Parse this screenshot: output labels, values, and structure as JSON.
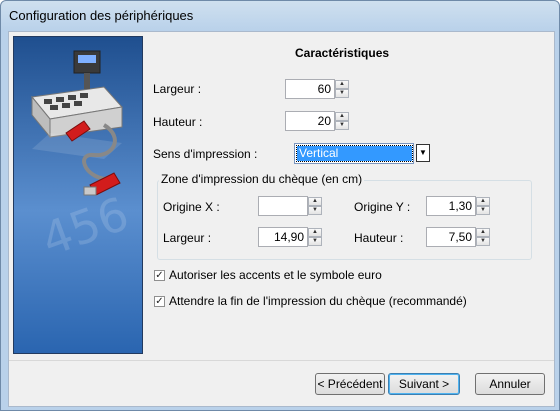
{
  "window": {
    "title": "Configuration des périphériques"
  },
  "main": {
    "heading": "Caractéristiques",
    "largeur_label": "Largeur :",
    "largeur_value": "60",
    "hauteur_label": "Hauteur :",
    "hauteur_value": "20",
    "sens_label": "Sens d'impression :",
    "sens_value": "Vertical",
    "zone": {
      "title": "Zone d'impression du chèque (en cm)",
      "origine_x_label": "Origine X :",
      "origine_x_value": "",
      "origine_y_label": "Origine Y :",
      "origine_y_value": "1,30",
      "largeur_label": "Largeur :",
      "largeur_value": "14,90",
      "hauteur_label": "Hauteur :",
      "hauteur_value": "7,50"
    },
    "check1": {
      "label": "Autoriser les accents et le symbole euro",
      "checked": true
    },
    "check2": {
      "label": "Attendre la fin de l'impression du chèque (recommandé)",
      "checked": true
    }
  },
  "footer": {
    "precedent": "< Précédent",
    "suivant": "Suivant >",
    "annuler": "Annuler"
  }
}
